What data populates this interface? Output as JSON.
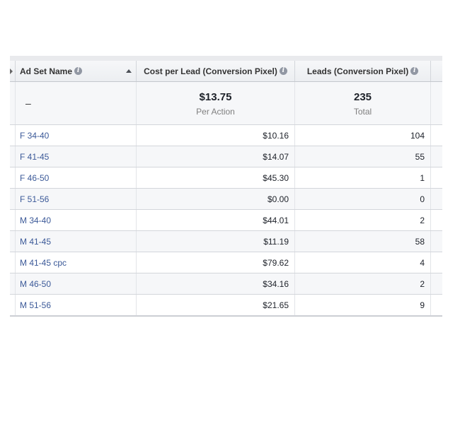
{
  "columns": {
    "name_label": "Ad Set Name",
    "cost_label": "Cost per Lead (Conversion Pixel)",
    "leads_label": "Leads (Conversion Pixel)"
  },
  "summary": {
    "name": "–",
    "cost_value": "$13.75",
    "cost_sub": "Per Action",
    "leads_value": "235",
    "leads_sub": "Total"
  },
  "rows": [
    {
      "name": "F 34-40",
      "cost": "$10.16",
      "leads": "104"
    },
    {
      "name": "F 41-45",
      "cost": "$14.07",
      "leads": "55"
    },
    {
      "name": "F 46-50",
      "cost": "$45.30",
      "leads": "1"
    },
    {
      "name": "F 51-56",
      "cost": "$0.00",
      "leads": "0"
    },
    {
      "name": "M 34-40",
      "cost": "$44.01",
      "leads": "2"
    },
    {
      "name": "M 41-45",
      "cost": "$11.19",
      "leads": "58"
    },
    {
      "name": "M 41-45 cpc",
      "cost": "$79.62",
      "leads": "4"
    },
    {
      "name": "M 46-50",
      "cost": "$34.16",
      "leads": "2"
    },
    {
      "name": "M 51-56",
      "cost": "$21.65",
      "leads": "9"
    }
  ],
  "icons": {
    "info": "info-icon",
    "sort": "sort-ascending-icon",
    "scroll_left": "caret-left-icon"
  },
  "colors": {
    "link": "#3b5998",
    "header_bg": "#f6f7f9",
    "muted_text": "#7f7f7f"
  }
}
